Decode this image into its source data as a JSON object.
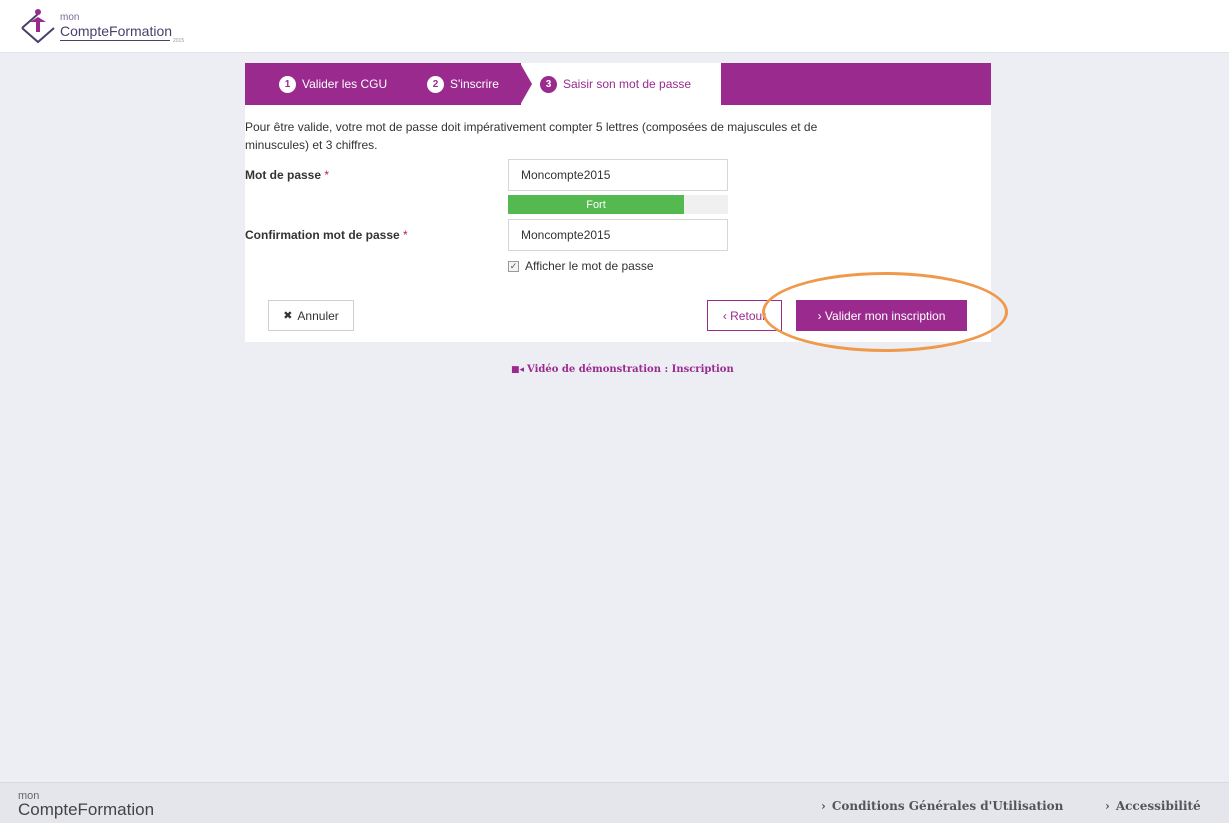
{
  "header": {
    "logo_small": "mon",
    "logo_text": "CompteFormation",
    "logo_sub": "2015"
  },
  "steps": [
    {
      "num": "1",
      "label": "Valider les CGU"
    },
    {
      "num": "2",
      "label": "S'inscrire"
    },
    {
      "num": "3",
      "label": "Saisir son mot de passe"
    }
  ],
  "form": {
    "intro_line1": "Pour être valide, votre mot de passe doit impérativement compter 5 lettres (composées de majuscules et de",
    "intro_line2": "minuscules) et 3 chiffres.",
    "password_label": "Mot de passe",
    "password_value": "Moncompte2015",
    "strength_label": "Fort",
    "strength_fraction": 0.8,
    "confirm_label": "Confirmation mot de passe",
    "confirm_value": "Moncompte2015",
    "required_mark": "*",
    "show_password_label": "Afficher le mot de passe",
    "show_password_checked": true
  },
  "buttons": {
    "cancel_label": "Annuler",
    "back_label": "‹ Retour",
    "submit_label": "› Valider mon inscription"
  },
  "video_link": "Vidéo de démonstration : Inscription",
  "footer": {
    "logo_small": "mon",
    "logo_text": "CompteFormation",
    "link1": "Conditions Générales d'Utilisation",
    "link2": "Accessibilité"
  },
  "colors": {
    "accent": "#9b2a8e",
    "strength": "#54b94f",
    "highlight": "#f0994a"
  }
}
